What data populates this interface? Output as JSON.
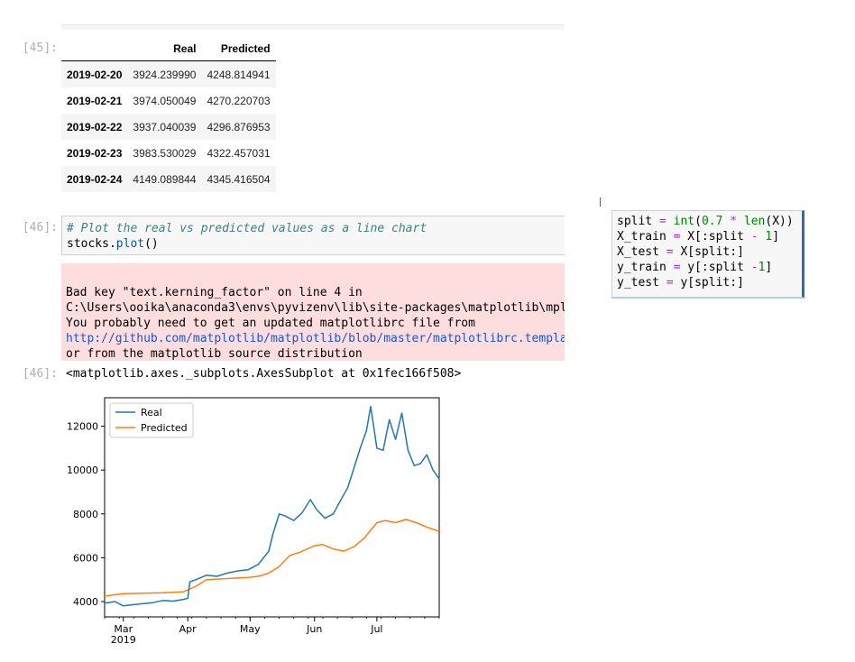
{
  "cells": {
    "out45_prompt": "[45]:",
    "in46_prompt": "[46]:",
    "out46_prompt": "[46]:"
  },
  "dataframe": {
    "columns": [
      "Real",
      "Predicted"
    ],
    "rows": [
      {
        "index": "2019-02-20",
        "real": "3924.239990",
        "predicted": "4248.814941"
      },
      {
        "index": "2019-02-21",
        "real": "3974.050049",
        "predicted": "4270.220703"
      },
      {
        "index": "2019-02-22",
        "real": "3937.040039",
        "predicted": "4296.876953"
      },
      {
        "index": "2019-02-23",
        "real": "3983.530029",
        "predicted": "4322.457031"
      },
      {
        "index": "2019-02-24",
        "real": "4149.089844",
        "predicted": "4345.416504"
      }
    ]
  },
  "code46": {
    "comment": "# Plot the real vs predicted values as a line chart",
    "obj": "stocks.",
    "fn": "plot",
    "tail": "()"
  },
  "stderr": {
    "line1": "Bad key \"text.kerning_factor\" on line 4 in",
    "line2": "C:\\Users\\ooika\\anaconda3\\envs\\pyvizenv\\lib\\site-packages\\matplotlib\\mpl-data\\stylelib\\_classic_test_patch.mplstyle.",
    "line3": "You probably need to get an updated matplotlibrc file from",
    "line4": "http://github.com/matplotlib/matplotlib/blob/master/matplotlibrc.template",
    "line5": "or from the matplotlib source distribution"
  },
  "out46_repr": "<matplotlib.axes._subplots.AxesSubplot at 0x1fec166f508>",
  "side_code": {
    "l1a": "split ",
    "l1op": "=",
    "l1b": " ",
    "l1fn": "int",
    "l1c": "(",
    "l1num": "0.7",
    "l1d": " ",
    "l1op2": "*",
    "l1e": " ",
    "l1fn2": "len",
    "l1f": "(X))",
    "l2a": "X_train ",
    "l2op": "=",
    "l2b": " X[:split ",
    "l2op2": "-",
    "l2c": " ",
    "l2num": "1",
    "l2d": "]",
    "l3a": "X_test ",
    "l3op": "=",
    "l3b": " X[split:]",
    "l4a": "y_train ",
    "l4op": "=",
    "l4b": " y[:split ",
    "l4op2": "-",
    "l4num": "1",
    "l4d": "]",
    "l5a": "y_test ",
    "l5op": "=",
    "l5b": " y[split:]"
  },
  "colors": {
    "real": "#1f77b4",
    "predicted": "#ff7f0e",
    "stderr_bg": "#fddddd",
    "prompt": "#b0b0b0"
  },
  "chart_data": {
    "type": "line",
    "x_ticks": [
      "Mar\n2019",
      "Apr",
      "May",
      "Jun",
      "Jul"
    ],
    "x_tick_labels": [
      "Mar",
      "Apr",
      "May",
      "Jun",
      "Jul"
    ],
    "x_year_label": "2019",
    "y_ticks": [
      4000,
      6000,
      8000,
      10000,
      12000
    ],
    "ylim": [
      3300,
      13300
    ],
    "xlim": [
      "2019-02-20",
      "2019-07-31"
    ],
    "legend_placement": "top-left",
    "grid": false,
    "series": [
      {
        "name": "Real",
        "x": [
          "2019-02-20",
          "2019-02-25",
          "2019-03-01",
          "2019-03-05",
          "2019-03-10",
          "2019-03-15",
          "2019-03-20",
          "2019-03-25",
          "2019-03-30",
          "2019-04-01",
          "2019-04-02",
          "2019-04-05",
          "2019-04-10",
          "2019-04-15",
          "2019-04-20",
          "2019-04-25",
          "2019-04-30",
          "2019-05-05",
          "2019-05-10",
          "2019-05-12",
          "2019-05-15",
          "2019-05-18",
          "2019-05-22",
          "2019-05-26",
          "2019-05-30",
          "2019-06-02",
          "2019-06-06",
          "2019-06-10",
          "2019-06-14",
          "2019-06-17",
          "2019-06-20",
          "2019-06-23",
          "2019-06-26",
          "2019-06-28",
          "2019-07-01",
          "2019-07-04",
          "2019-07-07",
          "2019-07-10",
          "2019-07-13",
          "2019-07-16",
          "2019-07-19",
          "2019-07-22",
          "2019-07-25",
          "2019-07-28",
          "2019-07-31"
        ],
        "values": [
          3924,
          4000,
          3800,
          3850,
          3900,
          3950,
          4050,
          4020,
          4100,
          4150,
          4900,
          5000,
          5200,
          5150,
          5300,
          5400,
          5450,
          5700,
          6300,
          7100,
          8000,
          7900,
          7700,
          8050,
          8650,
          8200,
          7800,
          8000,
          8700,
          9200,
          10100,
          11000,
          11800,
          12900,
          11000,
          10900,
          12300,
          11400,
          12600,
          10900,
          10200,
          10300,
          10700,
          10000,
          9600
        ]
      },
      {
        "name": "Predicted",
        "x": [
          "2019-02-20",
          "2019-03-01",
          "2019-03-10",
          "2019-03-20",
          "2019-03-30",
          "2019-04-05",
          "2019-04-10",
          "2019-04-20",
          "2019-04-30",
          "2019-05-05",
          "2019-05-10",
          "2019-05-15",
          "2019-05-20",
          "2019-05-25",
          "2019-06-01",
          "2019-06-05",
          "2019-06-10",
          "2019-06-15",
          "2019-06-20",
          "2019-06-25",
          "2019-07-01",
          "2019-07-05",
          "2019-07-10",
          "2019-07-15",
          "2019-07-20",
          "2019-07-25",
          "2019-07-31"
        ],
        "values": [
          4249,
          4360,
          4380,
          4400,
          4450,
          4700,
          5000,
          5050,
          5100,
          5150,
          5300,
          5600,
          6100,
          6250,
          6550,
          6600,
          6400,
          6300,
          6500,
          6900,
          7600,
          7700,
          7600,
          7750,
          7600,
          7400,
          7200
        ]
      }
    ]
  }
}
